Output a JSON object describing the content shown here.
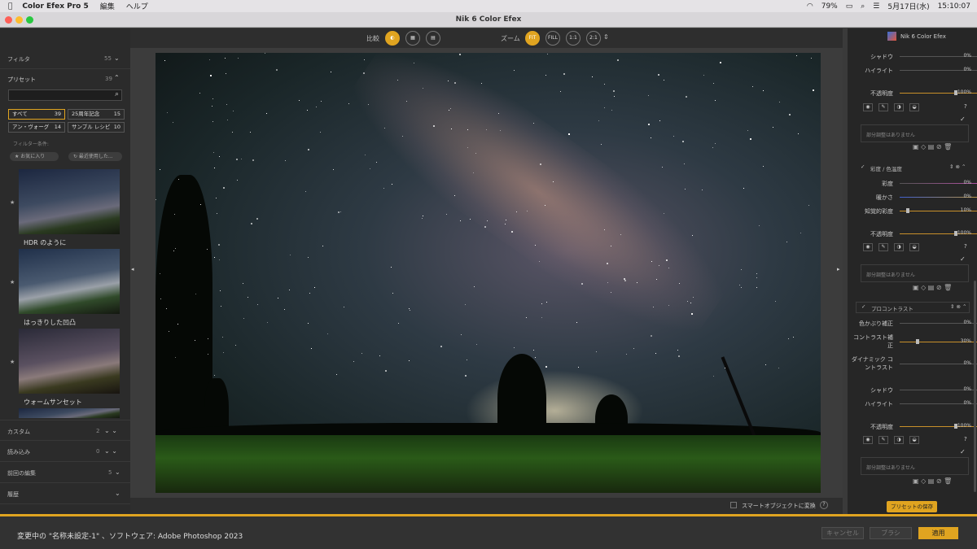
{
  "menubar": {
    "app": "Color Efex Pro 5",
    "edit": "編集",
    "help": "ヘルプ",
    "battery": "79%",
    "date": "5月17日(水)",
    "time": "15:10:07"
  },
  "window": {
    "title": "Nik 6 Color Efex"
  },
  "left": {
    "filters_label": "フィルタ",
    "filters_count": "55",
    "presets_label": "プリセット",
    "presets_count": "39",
    "tags": [
      {
        "label": "すべて",
        "count": "39"
      },
      {
        "label": "25周年記念",
        "count": "15"
      },
      {
        "label": "アン・ヴォーグ",
        "count": "14"
      },
      {
        "label": "サンプル レシピ",
        "count": "10"
      }
    ],
    "filter_conditions": "フィルター条件:",
    "chip_fav": "★ お気に入り",
    "chip_recent": "↻ 最近使用した...",
    "thumbs": [
      {
        "label": "HDR のように"
      },
      {
        "label": "はっきりした凹凸"
      },
      {
        "label": "ウォームサンセット"
      }
    ],
    "custom_label": "カスタム",
    "custom_count": "2",
    "import_label": "読み込み",
    "import_count": "0",
    "prev_label": "前回の編集",
    "prev_count": "5",
    "history_label": "履歴"
  },
  "toolbar": {
    "compare": "比較",
    "zoom": "ズーム",
    "fit": "FIT",
    "fill": "FILL",
    "one": "1:1",
    "two": "2:1"
  },
  "status": {
    "smart_object": "スマートオブジェクトに変換"
  },
  "right": {
    "logo": "Nik 6 Color Efex",
    "shadow": "シャドウ",
    "highlight": "ハイライト",
    "opacity": "不透明度",
    "p0": "0%",
    "p100": "100%",
    "p10": "10%",
    "p30": "30%",
    "no_local": "部分調整はありません",
    "sec_sat": "彩度 / 色温度",
    "saturation": "彩度",
    "warmth": "暖かさ",
    "perc_sat": "知覚的彩度",
    "sec_pro": "プロコントラスト",
    "cast": "色かぶり補正",
    "contrast_a": "コントラスト補",
    "contrast_b": "正",
    "dyn_a": "ダイナミック コ",
    "dyn_b": "ントラスト",
    "save_preset": "プリセットの保存"
  },
  "footer": {
    "message": "変更中の \"名称未設定-1\" 、ソフトウェア: Adobe Photoshop 2023",
    "cancel": "キャンセル",
    "brush": "ブラシ",
    "apply": "適用"
  },
  "colors": {
    "accent": "#e0a420"
  }
}
